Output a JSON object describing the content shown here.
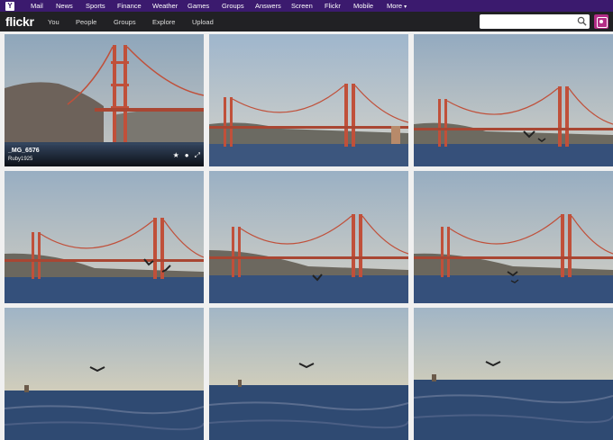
{
  "yahoo_bar": {
    "links": [
      "Mail",
      "News",
      "Sports",
      "Finance",
      "Weather",
      "Games",
      "Groups",
      "Answers",
      "Screen",
      "Flickr",
      "Mobile",
      "More"
    ]
  },
  "flickr_bar": {
    "logo": "flickr",
    "nav": [
      "You",
      "People",
      "Groups",
      "Explore",
      "Upload"
    ],
    "search_placeholder": ""
  },
  "photos": [
    {
      "type": "bridge-close",
      "hovered": true,
      "title": "_MG_6576",
      "owner": "Ruby1925"
    },
    {
      "type": "bridge-far"
    },
    {
      "type": "bridge-birds"
    },
    {
      "type": "bridge-birds2"
    },
    {
      "type": "bridge-mid"
    },
    {
      "type": "bridge-birds3"
    },
    {
      "type": "sea-bird"
    },
    {
      "type": "sea-bird"
    },
    {
      "type": "sea-bird"
    }
  ],
  "colors": {
    "yahoo_purple": "#3b1a6e",
    "flickr_dark": "#212124",
    "bridge_red": "#c0503a",
    "sky": "#aab8c8",
    "water": "#2f4a72"
  }
}
